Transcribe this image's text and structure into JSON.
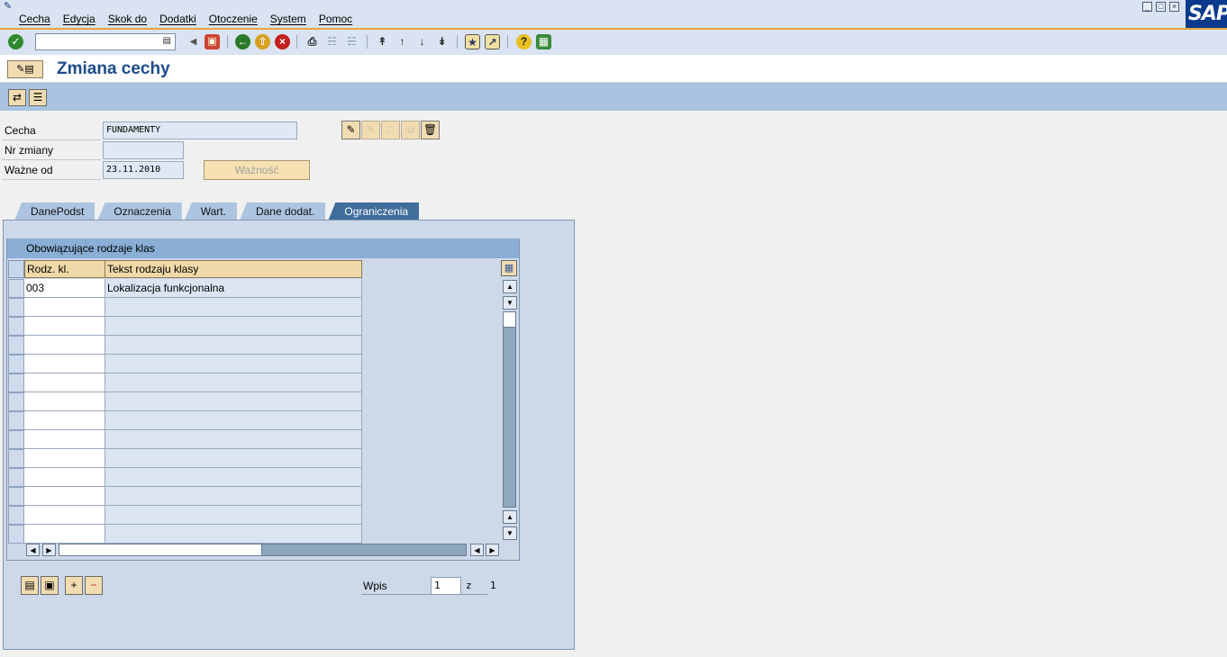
{
  "menu": {
    "items": [
      "Cecha",
      "Edycja",
      "Skok do",
      "Dodatki",
      "Otoczenie",
      "System",
      "Pomoc"
    ]
  },
  "brand": {
    "logo": "SAP"
  },
  "toolbar": {
    "command_value": "",
    "icons": [
      "enter-icon",
      "back-icon",
      "exit-icon",
      "cancel-icon",
      "print-icon",
      "find-icon",
      "find-next-icon",
      "first-page-icon",
      "prev-page-icon",
      "next-page-icon",
      "last-page-icon",
      "new-session-icon",
      "shortcut-icon",
      "help-icon",
      "layout-icon"
    ]
  },
  "title": {
    "text": "Zmiana cechy"
  },
  "fields": {
    "cecha_label": "Cecha",
    "cecha_value": "FUNDAMENTY",
    "nr_zmiany_label": "Nr zmiany",
    "nr_zmiany_value": "",
    "wazne_od_label": "Ważne od",
    "wazne_od_value": "23.11.2010",
    "waznosc_button": "Ważność"
  },
  "tabs": [
    {
      "label": "DanePodst",
      "active": false
    },
    {
      "label": "Oznaczenia",
      "active": false
    },
    {
      "label": "Wart.",
      "active": false
    },
    {
      "label": "Dane dodat.",
      "active": false
    },
    {
      "label": "Ograniczenia",
      "active": true
    }
  ],
  "group": {
    "title": "Obowiązujące rodzaje klas"
  },
  "table": {
    "columns": [
      "Rodz. kl.",
      "Tekst rodzaju klasy"
    ],
    "rows": [
      [
        "003",
        "Lokalizacja funkcjonalna"
      ],
      [
        "",
        ""
      ],
      [
        "",
        ""
      ],
      [
        "",
        ""
      ],
      [
        "",
        ""
      ],
      [
        "",
        ""
      ],
      [
        "",
        ""
      ],
      [
        "",
        ""
      ],
      [
        "",
        ""
      ],
      [
        "",
        ""
      ],
      [
        "",
        ""
      ],
      [
        "",
        ""
      ],
      [
        "",
        ""
      ],
      [
        "",
        ""
      ]
    ]
  },
  "entry": {
    "label": "Wpis",
    "current": "1",
    "of_label": "z",
    "total": "1"
  },
  "colors": {
    "menubar_bg": "#d9e3f1",
    "toolbar_accent": "#e8a33c",
    "title_color": "#1e4c8a",
    "apptoolbar_bg": "#a9c2e0",
    "tab_active": "#3f6d9c",
    "panel_bg": "#cdd9e8",
    "header_cell_bg": "#f0d9a8",
    "sap_blue": "#0a3a8c"
  }
}
